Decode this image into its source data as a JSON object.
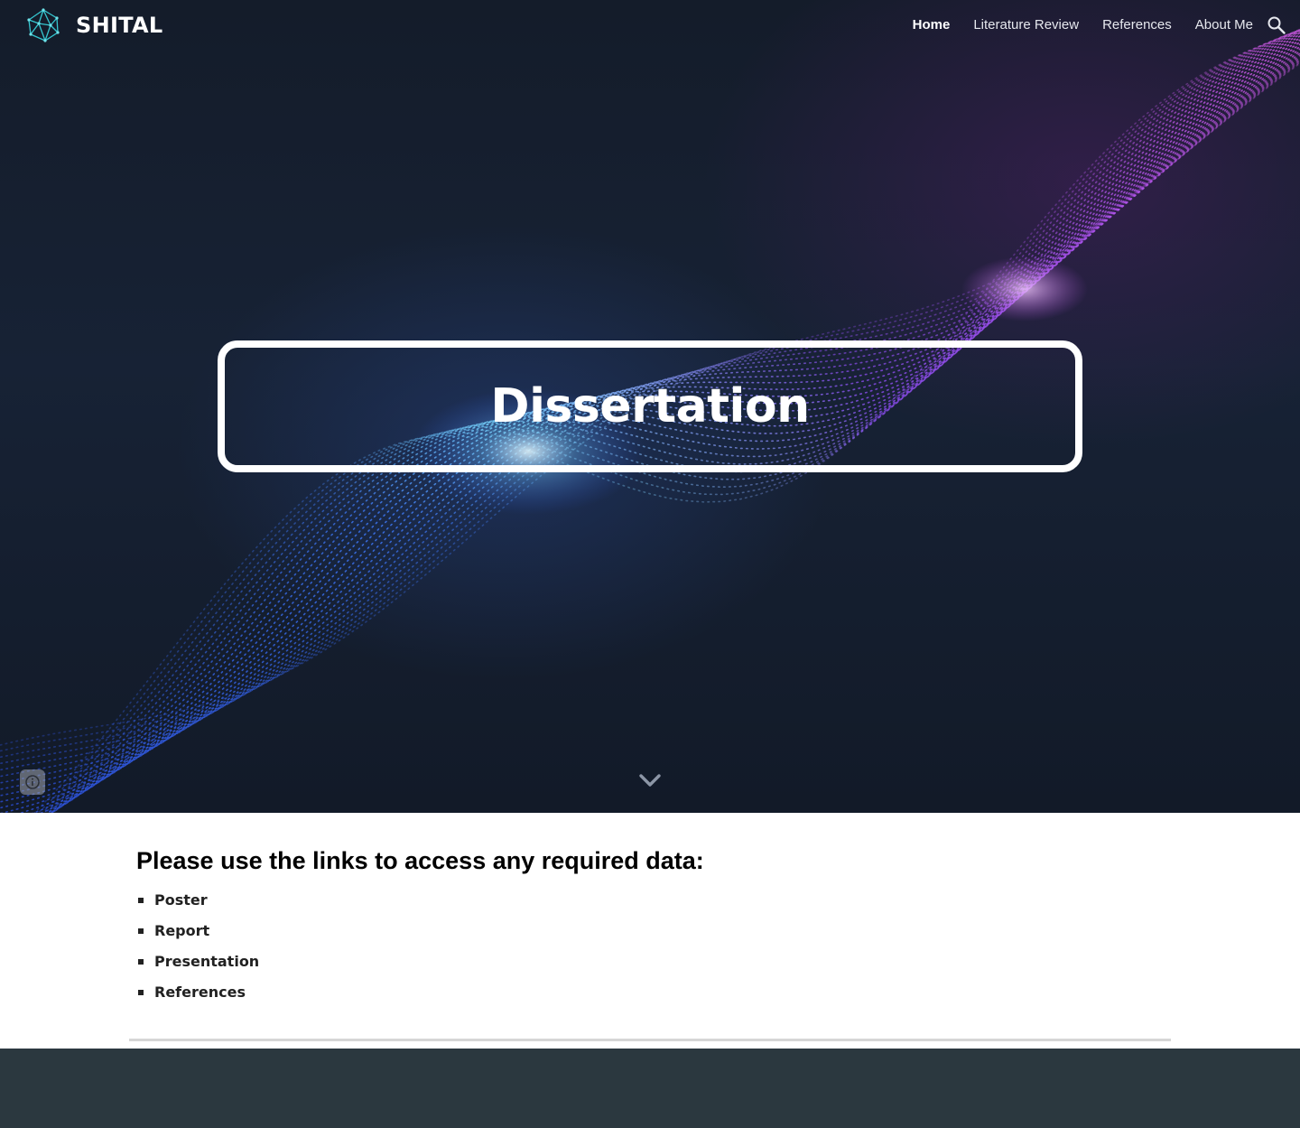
{
  "header": {
    "site_title": "SHITAL",
    "nav": [
      {
        "label": "Home",
        "active": true
      },
      {
        "label": "Literature Review",
        "active": false
      },
      {
        "label": "References",
        "active": false
      },
      {
        "label": "About Me",
        "active": false
      }
    ],
    "search_icon": "search-icon",
    "logo_icon": "network-polyhedron-logo"
  },
  "hero": {
    "title": "Dissertation",
    "scroll_icon": "chevron-down-icon",
    "info_icon": "info-icon"
  },
  "main": {
    "heading": "Please use the links to access any required data:",
    "links": [
      {
        "label": "Poster"
      },
      {
        "label": "Report"
      },
      {
        "label": "Presentation"
      },
      {
        "label": "References"
      }
    ]
  },
  "colors": {
    "footer_bg": "#2b383f",
    "hero_bg": "#141c2a",
    "accent_cyan": "#35c6d0",
    "wave_blue": "#3d6cff",
    "wave_purple": "#c04ee6"
  }
}
